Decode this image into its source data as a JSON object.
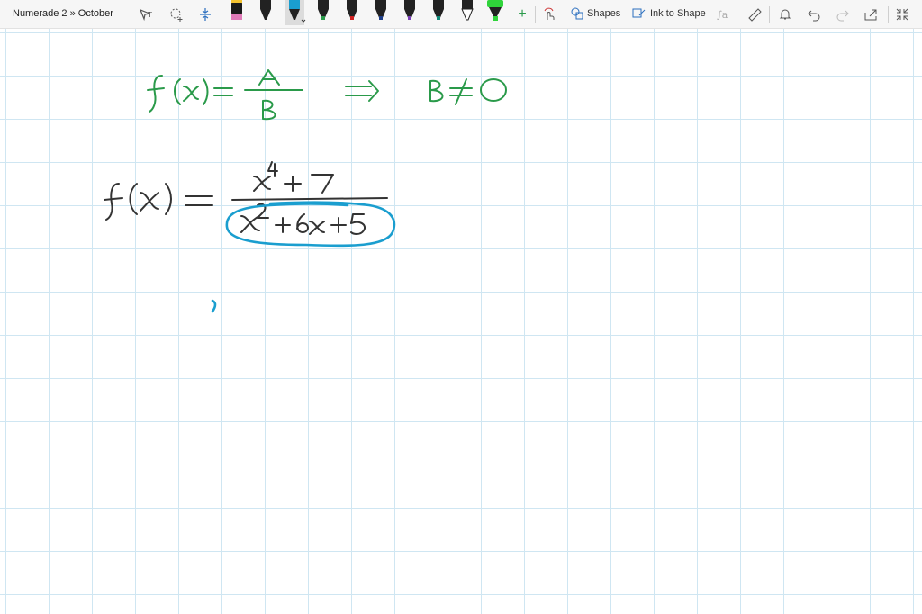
{
  "window": {
    "breadcrumb": "Numerade 2 » October"
  },
  "toolbar": {
    "shapes_label": "Shapes",
    "ink_to_shape_label": "Ink to Shape",
    "icons": [
      "lasso-select-icon",
      "add-space-icon",
      "eraser-icon",
      "pen-black",
      "pen-black",
      "pen-teal",
      "pen-green",
      "pen-red",
      "pen-navy",
      "pen-purple",
      "pen-teal-dark",
      "pen-black",
      "highlighter-green",
      "add-pen-icon",
      "touch-writing-icon",
      "shapes-icon",
      "ink-to-shape-icon",
      "ink-to-math-icon",
      "ruler-icon",
      "bell-icon",
      "undo-icon",
      "redo-icon",
      "share-icon",
      "fullscreen-icon"
    ]
  },
  "colors": {
    "green_ink": "#2a9a4a",
    "dark_ink": "#333333",
    "teal_ink": "#1a9ecf",
    "selected_pen": "#1a9ecf",
    "grid": "#cfe6f2"
  }
}
